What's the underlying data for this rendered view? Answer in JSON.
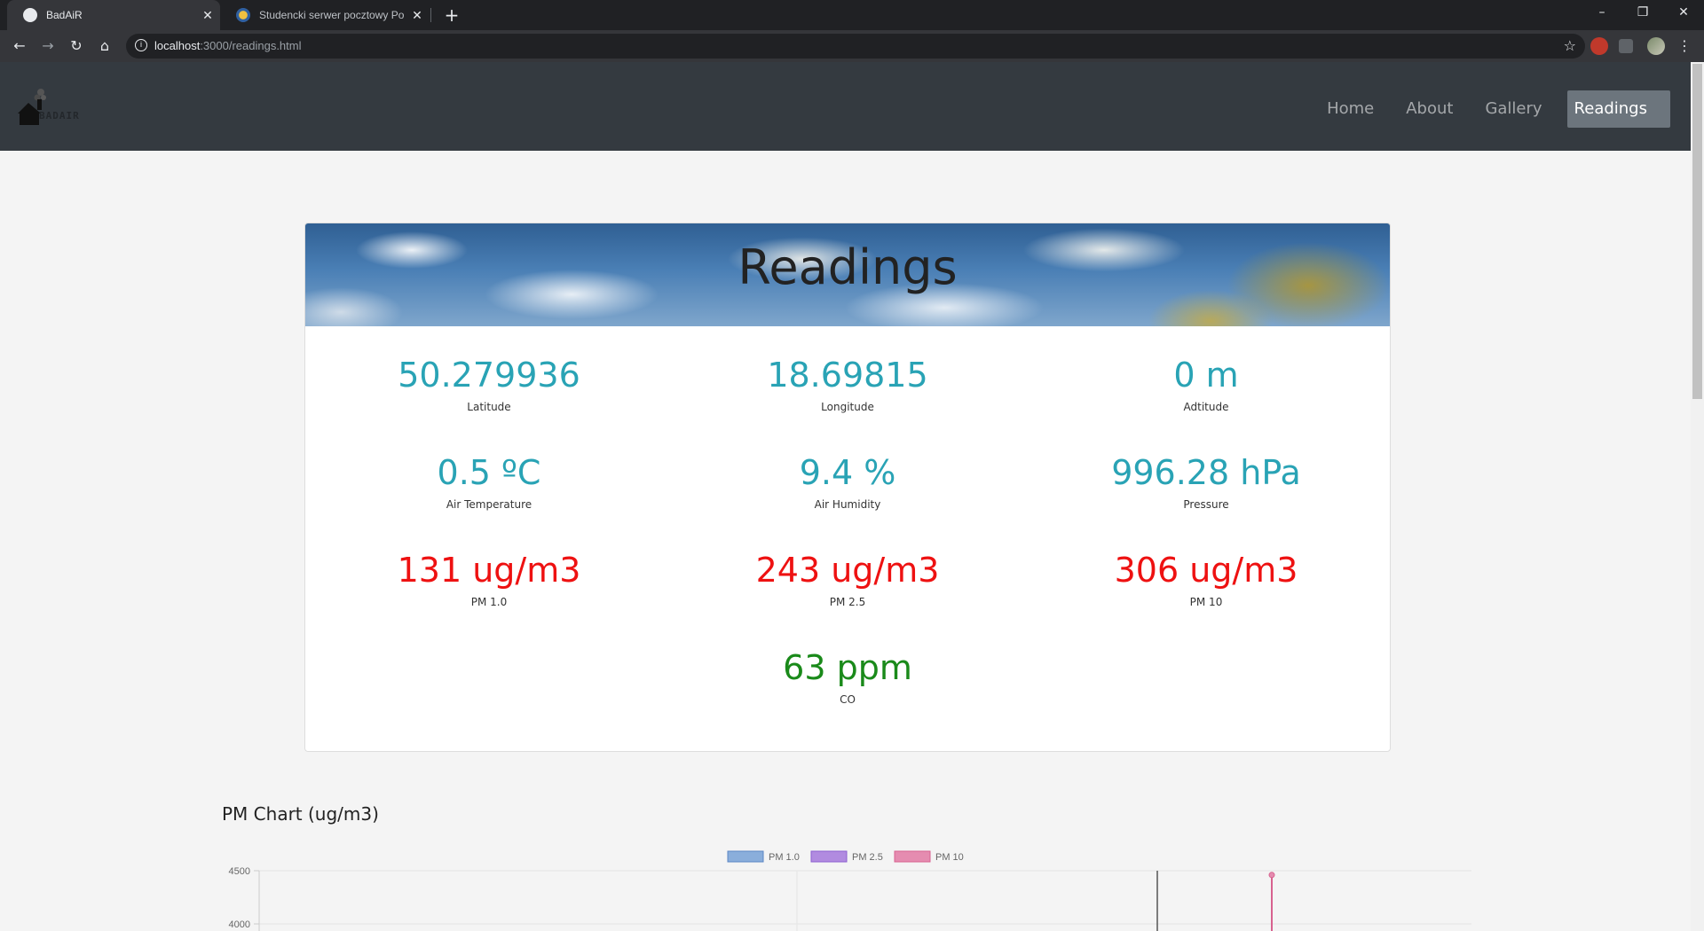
{
  "browser": {
    "tabs": [
      {
        "title": "BadAiR",
        "active": true
      },
      {
        "title": "Studencki serwer pocztowy Politechniki Śląskiej",
        "active": false
      }
    ],
    "url_host": "localhost",
    "url_path": ":3000/readings.html"
  },
  "site": {
    "logo_text": "BADAIR",
    "nav": [
      {
        "label": "Home",
        "active": false
      },
      {
        "label": "About",
        "active": false
      },
      {
        "label": "Gallery",
        "active": false
      },
      {
        "label": "Readings",
        "active": true
      }
    ]
  },
  "readings": {
    "title": "Readings",
    "items": [
      {
        "value": "50.279936",
        "label": "Latitude",
        "color": "#29a3b5"
      },
      {
        "value": "18.69815",
        "label": "Longitude",
        "color": "#29a3b5"
      },
      {
        "value": "0 m",
        "label": "Adtitude",
        "color": "#29a3b5"
      },
      {
        "value": "0.5 ºC",
        "label": "Air Temperature",
        "color": "#29a3b5"
      },
      {
        "value": "9.4 %",
        "label": "Air Humidity",
        "color": "#29a3b5"
      },
      {
        "value": "996.28 hPa",
        "label": "Pressure",
        "color": "#29a3b5"
      },
      {
        "value": "131 ug/m3",
        "label": "PM 1.0",
        "color": "#ee1111"
      },
      {
        "value": "243 ug/m3",
        "label": "PM 2.5",
        "color": "#ee1111"
      },
      {
        "value": "306 ug/m3",
        "label": "PM 10",
        "color": "#ee1111"
      },
      {
        "value": "63 ppm",
        "label": "CO",
        "color": "#1a8a1a"
      }
    ]
  },
  "pm_chart": {
    "heading": "PM Chart (ug/m3)"
  },
  "chart_data": {
    "type": "line",
    "title": "",
    "series": [
      {
        "name": "PM 1.0",
        "color": "#8aaedb",
        "border": "#5b86c4"
      },
      {
        "name": "PM 2.5",
        "color": "#b18be0",
        "border": "#8d5fd0"
      },
      {
        "name": "PM 10",
        "color": "#e58cb0",
        "border": "#d8628f"
      }
    ],
    "y_ticks": [
      "4500",
      "4000"
    ],
    "ylim_visible": [
      4000,
      4500
    ],
    "visible_points": [
      {
        "series": "PM 10",
        "y": 4460
      }
    ]
  }
}
